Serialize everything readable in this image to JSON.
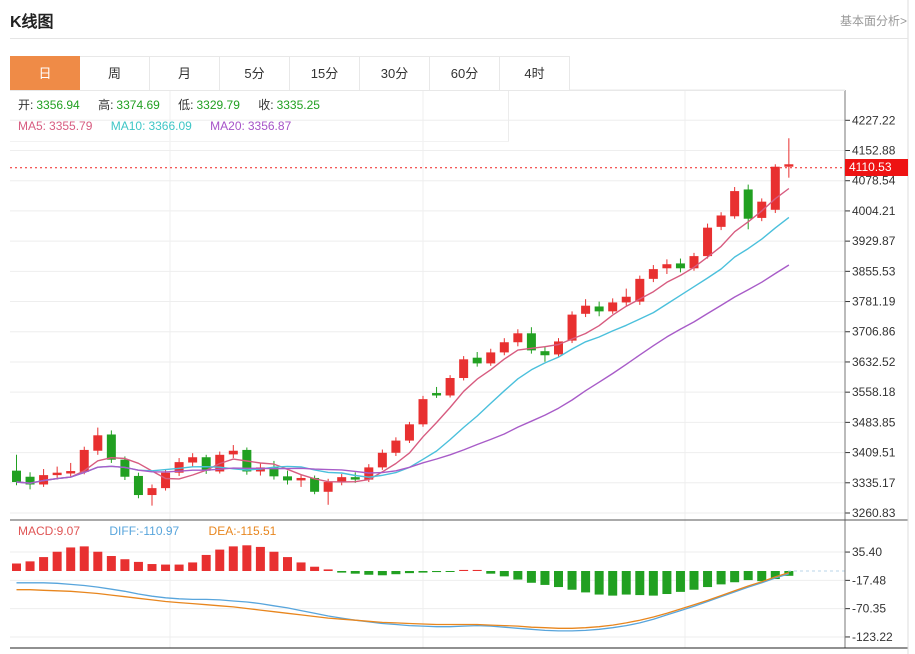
{
  "header": {
    "title": "K线图",
    "link": "基本面分析>"
  },
  "tabs": {
    "items": [
      {
        "label": "日",
        "active": true
      },
      {
        "label": "周",
        "active": false
      },
      {
        "label": "月",
        "active": false
      },
      {
        "label": "5分",
        "active": false
      },
      {
        "label": "15分",
        "active": false
      },
      {
        "label": "30分",
        "active": false
      },
      {
        "label": "60分",
        "active": false
      },
      {
        "label": "4时",
        "active": false
      }
    ]
  },
  "legend": {
    "open_label": "开:",
    "open_value": "3356.94",
    "high_label": "高:",
    "high_value": "3374.69",
    "low_label": "低:",
    "low_value": "3329.79",
    "close_label": "收:",
    "close_value": "3335.25",
    "ma5_label": "MA5:",
    "ma5_value": "3355.79",
    "ma10_label": "MA10:",
    "ma10_value": "3366.09",
    "ma20_label": "MA20:",
    "ma20_value": "3356.87"
  },
  "macd_legend": {
    "macd": "MACD:9.07",
    "diff": "DIFF:-110.97",
    "dea": "DEA:-115.51"
  },
  "current_price_label": "4110.53",
  "chart_data": {
    "type": "candlestick",
    "indicator": "MACD",
    "price_axis_values": [
      4227.22,
      4152.88,
      4078.54,
      4004.21,
      3929.87,
      3855.53,
      3781.19,
      3706.86,
      3632.52,
      3558.18,
      3483.85,
      3409.51,
      3335.17,
      3260.83
    ],
    "macd_axis_values": [
      35.4,
      -17.48,
      -70.35,
      -123.22
    ],
    "current_price": 4110.53,
    "ma_periods": [
      5,
      10,
      20
    ],
    "candles": [
      [
        3365,
        3404,
        3329,
        3337
      ],
      [
        3350,
        3361,
        3319,
        3331
      ],
      [
        3331,
        3369,
        3325,
        3354
      ],
      [
        3354,
        3375,
        3343,
        3360
      ],
      [
        3358,
        3384,
        3350,
        3364
      ],
      [
        3362,
        3424,
        3356,
        3416
      ],
      [
        3414,
        3471,
        3404,
        3452
      ],
      [
        3454,
        3464,
        3384,
        3392
      ],
      [
        3392,
        3400,
        3342,
        3350
      ],
      [
        3352,
        3360,
        3297,
        3305
      ],
      [
        3305,
        3331,
        3279,
        3322
      ],
      [
        3322,
        3368,
        3316,
        3360
      ],
      [
        3360,
        3396,
        3352,
        3386
      ],
      [
        3385,
        3408,
        3375,
        3398
      ],
      [
        3398,
        3404,
        3357,
        3365
      ],
      [
        3363,
        3412,
        3358,
        3404
      ],
      [
        3405,
        3428,
        3396,
        3414
      ],
      [
        3416,
        3422,
        3355,
        3363
      ],
      [
        3363,
        3383,
        3353,
        3373
      ],
      [
        3373,
        3389,
        3343,
        3351
      ],
      [
        3351,
        3365,
        3331,
        3341
      ],
      [
        3341,
        3355,
        3325,
        3347
      ],
      [
        3347,
        3353,
        3307,
        3313
      ],
      [
        3313,
        3345,
        3281,
        3337
      ],
      [
        3337,
        3357,
        3329,
        3349
      ],
      [
        3349,
        3361,
        3335,
        3343
      ],
      [
        3343,
        3381,
        3337,
        3373
      ],
      [
        3373,
        3417,
        3367,
        3409
      ],
      [
        3409,
        3447,
        3401,
        3439
      ],
      [
        3439,
        3485,
        3433,
        3479
      ],
      [
        3479,
        3549,
        3473,
        3541
      ],
      [
        3556,
        3571,
        3544,
        3550
      ],
      [
        3550,
        3600,
        3545,
        3593
      ],
      [
        3593,
        3647,
        3587,
        3639
      ],
      [
        3643,
        3657,
        3621,
        3629
      ],
      [
        3629,
        3665,
        3623,
        3656
      ],
      [
        3656,
        3691,
        3649,
        3681
      ],
      [
        3681,
        3713,
        3671,
        3703
      ],
      [
        3703,
        3718,
        3653,
        3661
      ],
      [
        3659,
        3671,
        3633,
        3649
      ],
      [
        3651,
        3691,
        3645,
        3683
      ],
      [
        3685,
        3757,
        3679,
        3749
      ],
      [
        3751,
        3787,
        3743,
        3771
      ],
      [
        3769,
        3781,
        3745,
        3757
      ],
      [
        3757,
        3789,
        3751,
        3779
      ],
      [
        3779,
        3813,
        3771,
        3793
      ],
      [
        3781,
        3845,
        3773,
        3837
      ],
      [
        3837,
        3871,
        3829,
        3861
      ],
      [
        3863,
        3885,
        3849,
        3873
      ],
      [
        3875,
        3887,
        3853,
        3863
      ],
      [
        3863,
        3901,
        3857,
        3893
      ],
      [
        3893,
        3973,
        3887,
        3963
      ],
      [
        3965,
        4001,
        3957,
        3993
      ],
      [
        3991,
        4063,
        3985,
        4053
      ],
      [
        4057,
        4069,
        3959,
        3985
      ],
      [
        3987,
        4035,
        3979,
        4027
      ],
      [
        4007,
        4119,
        3999,
        4113
      ],
      [
        4113,
        4183,
        4086,
        4119
      ]
    ],
    "macd": {
      "hist": [
        14,
        18,
        26,
        36,
        44,
        46,
        36,
        28,
        22,
        17,
        13,
        12,
        12,
        16,
        30,
        40,
        46,
        48,
        45,
        36,
        26,
        16,
        8,
        3,
        -3,
        -5,
        -7,
        -8,
        -6,
        -4,
        -3,
        -2,
        -1,
        2,
        2,
        -5,
        -10,
        -16,
        -22,
        -26,
        -30,
        -35,
        -40,
        -44,
        -46,
        -44,
        -45,
        -46,
        -43,
        -39,
        -35,
        -30,
        -25,
        -21,
        -17,
        -19,
        -15,
        -9
      ],
      "diff": [
        -22,
        -22,
        -22,
        -23,
        -25,
        -27,
        -30,
        -34,
        -38,
        -43,
        -47,
        -50,
        -52,
        -53,
        -53,
        -54,
        -56,
        -58,
        -61,
        -65,
        -69,
        -74,
        -79,
        -84,
        -88,
        -92,
        -95,
        -98,
        -100,
        -102,
        -103,
        -104,
        -104,
        -103,
        -102,
        -103,
        -105,
        -107,
        -109,
        -111,
        -112,
        -112,
        -111,
        -109,
        -106,
        -102,
        -97,
        -90,
        -82,
        -74,
        -66,
        -57,
        -48,
        -39,
        -30,
        -22,
        -13,
        -5
      ],
      "dea": [
        -35,
        -35,
        -36,
        -37,
        -38,
        -40,
        -42,
        -45,
        -48,
        -51,
        -54,
        -57,
        -59,
        -61,
        -63,
        -65,
        -67,
        -70,
        -73,
        -76,
        -79,
        -82,
        -85,
        -88,
        -90,
        -92,
        -94,
        -96,
        -97,
        -98,
        -99,
        -100,
        -100,
        -100,
        -100,
        -101,
        -102,
        -103,
        -105,
        -106,
        -107,
        -107,
        -106,
        -104,
        -101,
        -97,
        -92,
        -86,
        -79,
        -71,
        -63,
        -55,
        -46,
        -37,
        -28,
        -20,
        -11,
        -3
      ]
    },
    "colors": {
      "up": "#e83030",
      "down": "#21a021",
      "ma5": "#d75c80",
      "ma10": "#4bc0dc",
      "ma20": "#a85cc8",
      "diff": "#58a5dc",
      "dea": "#e8861e",
      "accent": "#ef8b47",
      "price_line": "#f22222",
      "price_tag_bg": "#ee1313"
    }
  }
}
